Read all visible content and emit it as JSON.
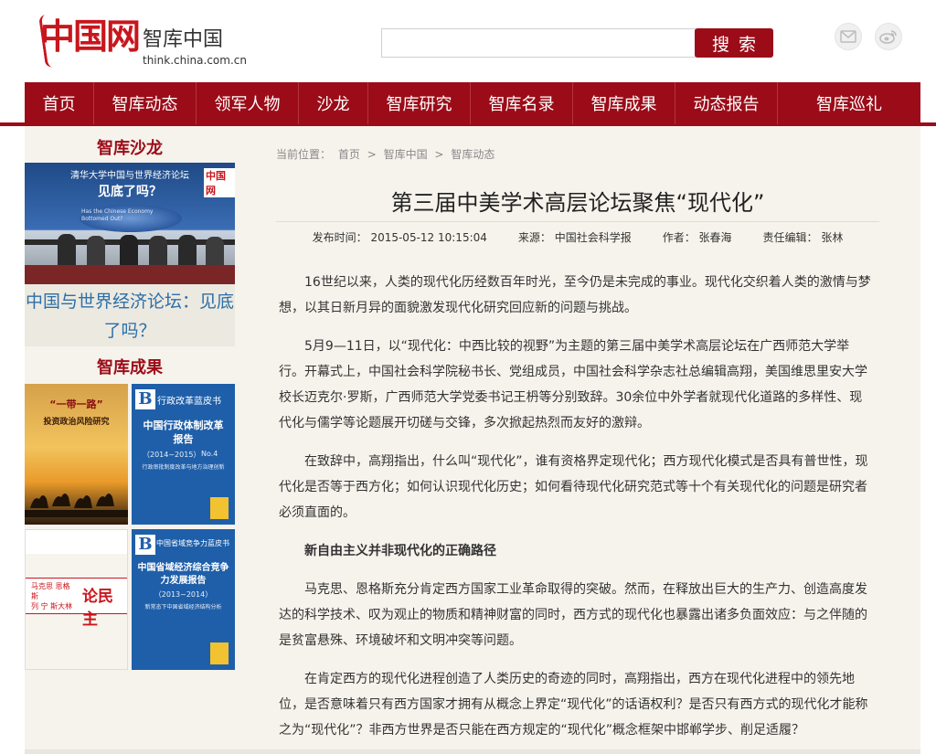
{
  "header": {
    "logo_main": "中国网",
    "logo_sub": "智库中国",
    "logo_url": "think.china.com.cn",
    "search_placeholder": "",
    "search_label": "搜索",
    "social_icons": [
      "mail-icon",
      "weibo-icon"
    ]
  },
  "nav": {
    "items": [
      "首页",
      "智库动态",
      "领军人物",
      "沙龙",
      "智库研究",
      "智库名录",
      "智库成果",
      "动态报告",
      "智库巡礼"
    ]
  },
  "sidebar": {
    "salon_title": "智库沙龙",
    "salon_photo": {
      "banner_title": "清华大学中国与世界经济论坛",
      "banner_sub": "见底了吗？",
      "screen_text": "Has the Chinese Economy Bottomed Out?",
      "logo": "中国网"
    },
    "salon_caption": "中国与世界经济论坛：见底了吗？",
    "results_title": "智库成果",
    "books": [
      {
        "title": "“一带一路”",
        "subtitle": "投资政治风险研究"
      },
      {
        "series": "行政改革蓝皮书",
        "title": "中国行政体制改革报告",
        "years": "（2014~2015）",
        "no": "No.4",
        "sub": "行政审批制度改革与地方治理创新"
      },
      {
        "authors": [
          "马克思",
          "恩格斯",
          "列",
          "宁",
          "斯大林"
        ],
        "title": "论民主"
      },
      {
        "series": "中国省域竞争力蓝皮书",
        "title": "中国省域经济综合竞争力发展报告",
        "years": "（2013~2014）",
        "sub": "新常态下中国省域经济结构分析"
      }
    ]
  },
  "article": {
    "breadcrumb_label": "当前位置：",
    "breadcrumb": [
      "首页",
      "智库中国",
      "智库动态"
    ],
    "breadcrumb_sep": ">",
    "title": "第三届中美学术高层论坛聚焦“现代化”",
    "meta": {
      "publish": "发布时间：  2015-05-12 10:15:04",
      "source": "来源：  中国社会科学报",
      "author": "作者：  张春海",
      "editor": "责任编辑：  张林"
    },
    "paragraphs": [
      "16世纪以来，人类的现代化历经数百年时光，至今仍是未完成的事业。现代化交织着人类的激情与梦想，以其日新月异的面貌激发现代化研究回应新的问题与挑战。",
      "5月9—11日，以“现代化：中西比较的视野”为主题的第三届中美学术高层论坛在广西师范大学举行。开幕式上，中国社会科学院秘书长、党组成员，中国社会科学杂志社总编辑高翔，美国维思里安大学校长迈克尔·罗斯，广西师范大学党委书记王枬等分别致辞。30余位中外学者就现代化道路的多样性、现代化与儒学等论题展开切磋与交锋，多次掀起热烈而友好的激辩。",
      "在致辞中，高翔指出，什么叫“现代化”，谁有资格界定现代化；西方现代化模式是否具有普世性，现代化是否等于西方化；如何认识现代化历史；如何看待现代化研究范式等十个有关现代化的问题是研究者必须直面的。",
      "新自由主义并非现代化的正确路径",
      "马克思、恩格斯充分肯定西方国家工业革命取得的突破。然而，在释放出巨大的生产力、创造高度发达的科学技术、叹为观止的物质和精神财富的同时，西方式的现代化也暴露出诸多负面效应：与之伴随的是贫富悬殊、环境破坏和文明冲突等问题。",
      "在肯定西方的现代化进程创造了人类历史的奇迹的同时，高翔指出，西方在现代化进程中的领先地位，是否意味着只有西方国家才拥有从概念上界定“现代化”的话语权利？是否只有西方式的现代化才能称之为“现代化”？非西方世界是否只能在西方规定的“现代化”概念框架中邯郸学步、削足适履？"
    ]
  },
  "colors": {
    "brand_red": "#9b0c18",
    "logo_red": "#c8161d",
    "panel_bg": "#f6f3ec",
    "caption_blue": "#2d6fa6"
  }
}
